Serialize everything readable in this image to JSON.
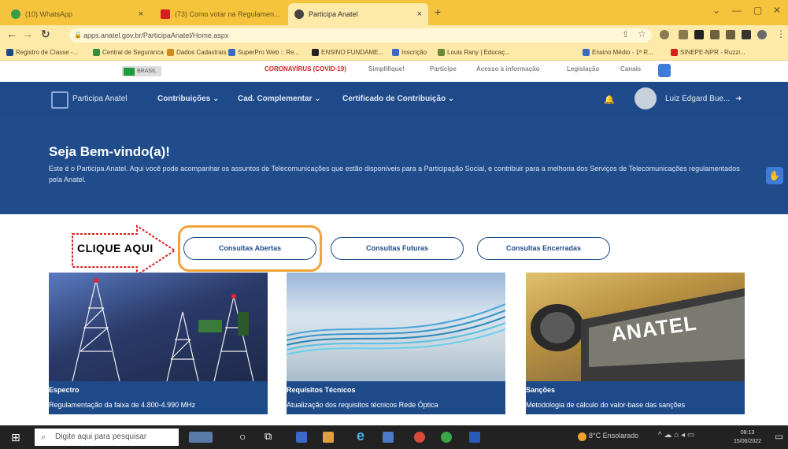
{
  "browser": {
    "tabs": [
      {
        "label": "(10) WhatsApp",
        "color": "#3a9b4a"
      },
      {
        "label": "(73) Como votar na Regulamen...",
        "color": "#d62020"
      },
      {
        "label": "Participa Anatel",
        "color": "#444444"
      }
    ],
    "new_tab_label": "+",
    "address": "apps.anatel.gov.br/ParticipaAnatel/Home.aspx",
    "bookmarks": [
      {
        "label": "Registro de Classe -...",
        "color": "#1f4a8a"
      },
      {
        "label": "Central de Seguranca",
        "color": "#3a8a3a"
      },
      {
        "label": "Dados Cadastrais",
        "color": "#d08a20"
      },
      {
        "label": "SuperPro Web :: Re...",
        "color": "#3a6ac8"
      },
      {
        "label": "ENSINO FUNDAME...",
        "color": "#222222"
      },
      {
        "label": "Inscrição",
        "color": "#3a6ac8"
      },
      {
        "label": "Louis Rany | Educaç...",
        "color": "#6a8a3a"
      },
      {
        "label": "Ensino Médio - 1ª R...",
        "color": "#3a6ac8"
      },
      {
        "label": "SINEPE-NPR - Ruzzi...",
        "color": "#d62020"
      }
    ]
  },
  "gov_bar": {
    "brasil": "BRASIL",
    "links": [
      "CORONAVÍRUS (COVID-19)",
      "Simplifique!",
      "Participe",
      "Acesso à informação",
      "Legislação",
      "Canais"
    ]
  },
  "main_nav": {
    "logo": "Participa Anatel",
    "items": [
      "Contribuições",
      "Cad. Complementar",
      "Certificado de Contribuição"
    ],
    "user": "Luiz Edgard Bue..."
  },
  "hero": {
    "title": "Seja Bem-vindo(a)!",
    "text": "Este é o Participa Anatel. Aqui você pode acompanhar os assuntos de Telecomunicações que estão disponíveis para a Participação Social, e contribuir para a melhoria dos Serviços de Telecomunicações regulamentados pela Anatel."
  },
  "annotation": {
    "label": "CLIQUE AQUI"
  },
  "filters": [
    "Consultas Abertas",
    "Consultas Futuras",
    "Consultas Encerradas"
  ],
  "cards": [
    {
      "title": "Espectro",
      "desc": "Regulamentação da faixa de 4.800-4.990 MHz"
    },
    {
      "title": "Requisitos Técnicos",
      "desc": "Atualização dos requisitos técnicos Rede Óptica"
    },
    {
      "title": "Sanções",
      "desc": "Metodologia de cálculo do valor-base das sanções",
      "sign": "ANATEL"
    }
  ],
  "taskbar": {
    "search_placeholder": "Digite aqui para pesquisar",
    "weather": "8°C  Ensolarado",
    "time": "08:13",
    "date": "15/06/2022"
  }
}
